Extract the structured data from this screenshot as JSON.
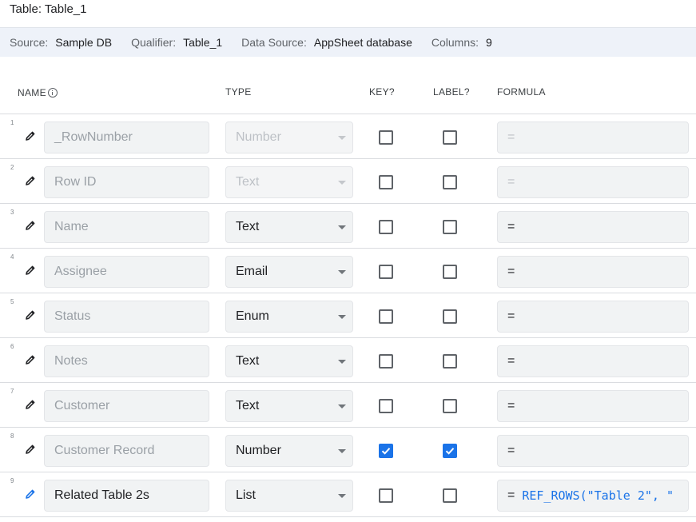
{
  "page": {
    "title": "Table: Table_1"
  },
  "info": {
    "source_label": "Source:",
    "source": "Sample DB",
    "qualifier_label": "Qualifier:",
    "qualifier": "Table_1",
    "datasource_label": "Data Source:",
    "datasource": "AppSheet database",
    "columns_label": "Columns:",
    "columns": "9"
  },
  "headers": {
    "name": "NAME",
    "type": "TYPE",
    "key": "KEY?",
    "label": "LABEL?",
    "formula": "FORMULA"
  },
  "icons": {
    "edit": "pencil-icon",
    "info": "info-icon",
    "dropdown": "caret-down-icon",
    "check": "check-icon"
  },
  "colors": {
    "accent": "#1a73e8",
    "info_bar": "#eef2f9"
  },
  "rows": [
    {
      "num": "1",
      "name": "_RowNumber",
      "type": "Number",
      "key": false,
      "label": false,
      "formula": "=",
      "expr": ""
    },
    {
      "num": "2",
      "name": "Row ID",
      "type": "Text",
      "key": false,
      "label": false,
      "formula": "=",
      "expr": ""
    },
    {
      "num": "3",
      "name": "Name",
      "type": "Text",
      "key": false,
      "label": false,
      "formula": "=",
      "expr": ""
    },
    {
      "num": "4",
      "name": "Assignee",
      "type": "Email",
      "key": false,
      "label": false,
      "formula": "=",
      "expr": ""
    },
    {
      "num": "5",
      "name": "Status",
      "type": "Enum",
      "key": false,
      "label": false,
      "formula": "=",
      "expr": ""
    },
    {
      "num": "6",
      "name": "Notes",
      "type": "Text",
      "key": false,
      "label": false,
      "formula": "=",
      "expr": ""
    },
    {
      "num": "7",
      "name": "Customer",
      "type": "Text",
      "key": false,
      "label": false,
      "formula": "=",
      "expr": ""
    },
    {
      "num": "8",
      "name": "Customer Record",
      "type": "Number",
      "key": true,
      "label": true,
      "formula": "=",
      "expr": ""
    },
    {
      "num": "9",
      "name": "Related Table 2s",
      "type": "List",
      "key": false,
      "label": false,
      "formula": "=",
      "expr": "REF_ROWS(\"Table 2\", \""
    }
  ]
}
